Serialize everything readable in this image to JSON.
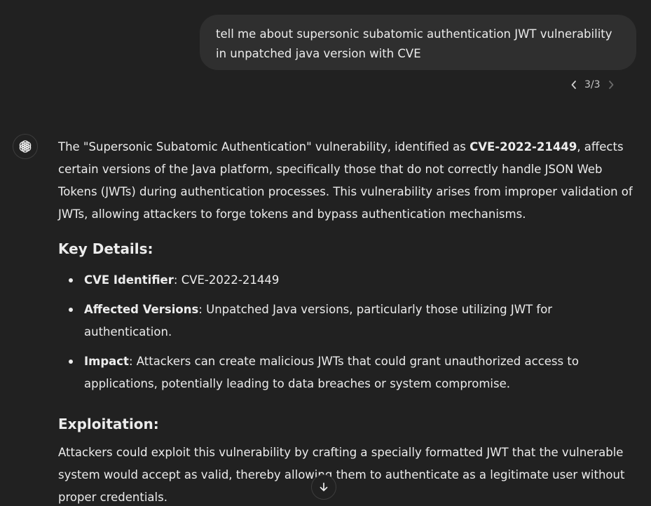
{
  "user_message": {
    "text": "tell me about supersonic subatomic authentication JWT vulnerability in unpatched java version with CVE"
  },
  "pager": {
    "prev_icon": "chevron-left-icon",
    "count": "3/3",
    "next_icon": "chevron-right-icon"
  },
  "assistant": {
    "avatar_icon": "openai-logo-icon",
    "intro": {
      "before": "The \"Supersonic Subatomic Authentication\" vulnerability, identified as ",
      "cve": "CVE-2022-21449",
      "after": ", affects certain versions of the Java platform, specifically those that do not correctly handle JSON Web Tokens (JWTs) during authentication processes. This vulnerability arises from improper validation of JWTs, allowing attackers to forge tokens and bypass authentication mechanisms."
    },
    "key_details_heading": "Key Details:",
    "key_details": [
      {
        "label": "CVE Identifier",
        "text": ": CVE-2022-21449"
      },
      {
        "label": "Affected Versions",
        "text": ": Unpatched Java versions, particularly those utilizing JWT for authentication."
      },
      {
        "label": "Impact",
        "text": ": Attackers can create malicious JWTs that could grant unauthorized access to applications, potentially leading to data breaches or system compromise."
      }
    ],
    "exploitation_heading": "Exploitation:",
    "exploitation_text": "Attackers could exploit this vulnerability by crafting a specially formatted JWT that the vulnerable system would accept as valid, thereby allowing them to authenticate as a legitimate user without proper credentials."
  },
  "scroll_button": {
    "icon": "arrow-down-icon"
  },
  "colors": {
    "background": "#212121",
    "user_bubble": "#2f2f2f",
    "text": "#ececec",
    "muted": "#b4b4b4"
  }
}
